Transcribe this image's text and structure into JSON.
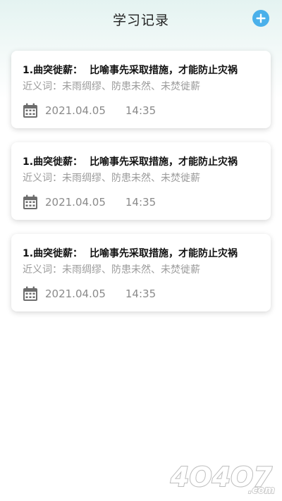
{
  "header": {
    "title": "学习记录",
    "add_icon": "plus-circle-icon"
  },
  "records": [
    {
      "index": "1.",
      "idiom": "曲突徙薪：",
      "definition": "比喻事先采取措施，才能防止灾祸",
      "synonyms": "近义词：未雨绸缪、防患未然、未焚徙薪",
      "date": "2021.04.05",
      "time": "14:35",
      "icon": "calendar-icon"
    },
    {
      "index": "1.",
      "idiom": "曲突徙薪：",
      "definition": "比喻事先采取措施，才能防止灾祸",
      "synonyms": "近义词：未雨绸缪、防患未然、未焚徙薪",
      "date": "2021.04.05",
      "time": "14:35",
      "icon": "calendar-icon"
    },
    {
      "index": "1.",
      "idiom": "曲突徙薪：",
      "definition": "比喻事先采取措施，才能防止灾祸",
      "synonyms": "近义词：未雨绸缪、防患未然、未焚徙薪",
      "date": "2021.04.05",
      "time": "14:35",
      "icon": "calendar-icon"
    }
  ],
  "watermark": {
    "text": "4O4O7.com"
  },
  "colors": {
    "accent": "#4ab0ea",
    "header_gradient_top": "#e4f3f1",
    "muted_text": "#9a9a9a",
    "icon_gray": "#6d6d6d"
  }
}
